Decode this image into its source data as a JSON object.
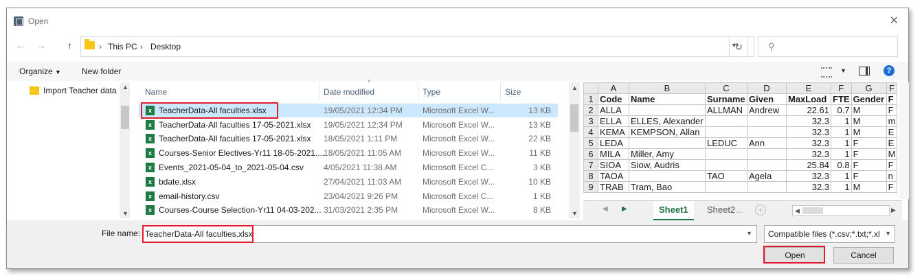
{
  "window": {
    "title": "Open"
  },
  "nav": {
    "back": "←",
    "forward": "→",
    "up": "↑",
    "breadcrumbs": [
      "This PC",
      "Desktop"
    ],
    "refresh": "↻",
    "search_placeholder": ""
  },
  "toolbar": {
    "organize": "Organize",
    "new_folder": "New folder",
    "help": "?"
  },
  "nav_pane": {
    "items": [
      {
        "label": "Import Teacher data"
      }
    ]
  },
  "file_list": {
    "columns": {
      "name": "Name",
      "date": "Date modified",
      "type": "Type",
      "size": "Size"
    },
    "rows": [
      {
        "name": "TeacherData-All faculties.xlsx",
        "date": "19/05/2021 12:34 PM",
        "type": "Microsoft Excel W...",
        "size": "13 KB",
        "selected": true
      },
      {
        "name": "TeacherData-All faculties 17-05-2021.xlsx",
        "date": "19/05/2021 12:34 PM",
        "type": "Microsoft Excel W...",
        "size": "13 KB"
      },
      {
        "name": "TeacherData-All faculties 17-05-2021.xlsx",
        "date": "18/05/2021 1:11 PM",
        "type": "Microsoft Excel W...",
        "size": "22 KB"
      },
      {
        "name": "Courses-Senior Electives-Yr11 18-05-2021....",
        "date": "18/05/2021 11:05 AM",
        "type": "Microsoft Excel W...",
        "size": "11 KB"
      },
      {
        "name": "Events_2021-05-04_to_2021-05-04.csv",
        "date": "4/05/2021 11:38 AM",
        "type": "Microsoft Excel C...",
        "size": "3 KB"
      },
      {
        "name": "bdate.xlsx",
        "date": "27/04/2021 11:03 AM",
        "type": "Microsoft Excel W...",
        "size": "10 KB"
      },
      {
        "name": "email-history.csv",
        "date": "23/04/2021 9:26 PM",
        "type": "Microsoft Excel C...",
        "size": "1 KB"
      },
      {
        "name": "Courses-Course Selection-Yr11 04-03-202...",
        "date": "31/03/2021 2:35 PM",
        "type": "Microsoft Excel W...",
        "size": "8 KB"
      }
    ]
  },
  "preview": {
    "col_letters": [
      "A",
      "B",
      "C",
      "D",
      "E",
      "F",
      "G",
      "F"
    ],
    "rows": [
      {
        "n": "1",
        "cells": [
          "Code",
          "Name",
          "Surname",
          "Given",
          "MaxLoad",
          "FTE",
          "Gender",
          "F"
        ]
      },
      {
        "n": "2",
        "cells": [
          "ALLA",
          "",
          "ALLMAN",
          "Andrew",
          "22.61",
          "0.7",
          "M",
          "F"
        ]
      },
      {
        "n": "3",
        "cells": [
          "ELLA",
          "ELLES, Alexander",
          "",
          "",
          "32.3",
          "1",
          "M",
          "m"
        ]
      },
      {
        "n": "4",
        "cells": [
          "KEMA",
          "KEMPSON, Allan",
          "",
          "",
          "32.3",
          "1",
          "M",
          "E"
        ]
      },
      {
        "n": "5",
        "cells": [
          "LEDA",
          "",
          "LEDUC",
          "Ann",
          "32.3",
          "1",
          "F",
          "E"
        ]
      },
      {
        "n": "6",
        "cells": [
          "MILA",
          "Miller, Amy",
          "",
          "",
          "32.3",
          "1",
          "F",
          "M"
        ]
      },
      {
        "n": "7",
        "cells": [
          "SIOA",
          "Siow, Audris",
          "",
          "",
          "25.84",
          "0.8",
          "F",
          "F"
        ]
      },
      {
        "n": "8",
        "cells": [
          "TAOA",
          "",
          "TAO",
          "Agela",
          "32.3",
          "1",
          "F",
          "n"
        ]
      },
      {
        "n": "9",
        "cells": [
          "TRAB",
          "Tram, Bao",
          "",
          "",
          "32.3",
          "1",
          "M",
          "F"
        ]
      }
    ],
    "tabs": [
      "Sheet1",
      "Sheet2"
    ],
    "tab_ellipsis": "...",
    "add_sheet": "+"
  },
  "bottom": {
    "file_name_label": "File name:",
    "file_name_value": "TeacherData-All faculties.xlsx",
    "filter_value": "Compatible files (*.csv;*.txt;*.xl",
    "open_label": "Open",
    "cancel_label": "Cancel"
  },
  "colors": {
    "highlight": "#e21c2a",
    "selection": "#cce8ff",
    "excel_green": "#217346"
  }
}
